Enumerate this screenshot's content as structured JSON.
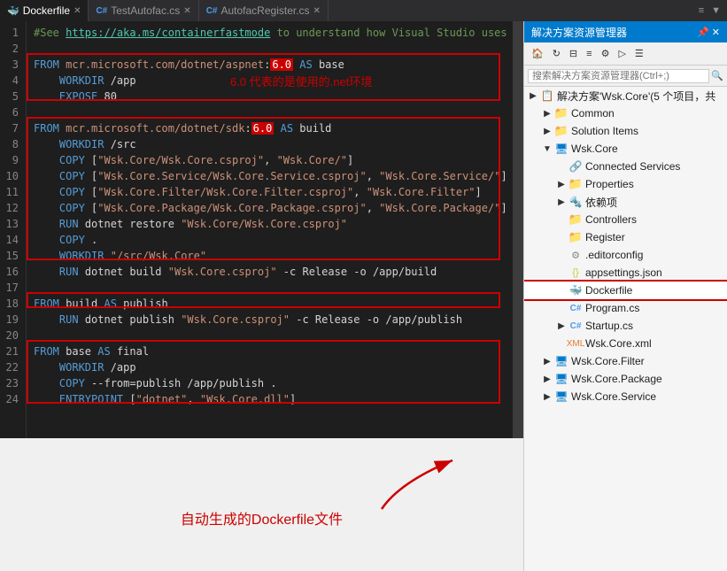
{
  "tabs": [
    {
      "label": "Dockerfile",
      "active": true,
      "modified": false
    },
    {
      "label": "TestAutofac.cs",
      "active": false
    },
    {
      "label": "AutofacRegister.cs",
      "active": false
    }
  ],
  "tab_actions": [
    "▼",
    "≡"
  ],
  "editor": {
    "lines": [
      {
        "num": 1,
        "content": "#See https://aka.ms/containerfastmode to understand how Visual Studio uses this Dockerfile to build yo",
        "type": "comment"
      },
      {
        "num": 2,
        "content": ""
      },
      {
        "num": 3,
        "content": "FROM mcr.microsoft.com/dotnet/aspnet:6.0 AS base",
        "highlight": "aspnet_from"
      },
      {
        "num": 4,
        "content": "    WORKDIR /app"
      },
      {
        "num": 5,
        "content": "    EXPOSE 80"
      },
      {
        "num": 6,
        "content": ""
      },
      {
        "num": 7,
        "content": "FROM mcr.microsoft.com/dotnet/sdk:6.0 AS build",
        "highlight": "sdk_from"
      },
      {
        "num": 8,
        "content": "    WORKDIR /src"
      },
      {
        "num": 9,
        "content": "    COPY [\"Wsk.Core/Wsk.Core.csproj\", \"Wsk.Core/\"]"
      },
      {
        "num": 10,
        "content": "    COPY [\"Wsk.Core.Service/Wsk.Core.Service.csproj\", \"Wsk.Core.Service/\"]"
      },
      {
        "num": 11,
        "content": "    COPY [\"Wsk.Core.Filter/Wsk.Core.Filter.csproj\", \"Wsk.Core.Filter\"]"
      },
      {
        "num": 12,
        "content": "    COPY [\"Wsk.Core.Package/Wsk.Core.Package.csproj\", \"Wsk.Core.Package/\"]"
      },
      {
        "num": 13,
        "content": "    RUN dotnet restore \"Wsk.Core/Wsk.Core.csproj\""
      },
      {
        "num": 14,
        "content": "    COPY ."
      },
      {
        "num": 15,
        "content": "    WORKDIR \"/src/Wsk.Core\""
      },
      {
        "num": 16,
        "content": "    RUN dotnet build \"Wsk.Core.csproj\" -c Release -o /app/build"
      },
      {
        "num": 17,
        "content": ""
      },
      {
        "num": 18,
        "content": "FROM build AS publish"
      },
      {
        "num": 19,
        "content": "    RUN dotnet publish \"Wsk.Core.csproj\" -c Release -o /app/publish"
      },
      {
        "num": 20,
        "content": ""
      },
      {
        "num": 21,
        "content": "FROM base AS final"
      },
      {
        "num": 22,
        "content": "    WORKDIR /app"
      },
      {
        "num": 23,
        "content": "    COPY --from=publish /app/publish ."
      },
      {
        "num": 24,
        "content": "    ENTRYPOINT [\"dotnet\", \"Wsk.Core.dll\"]"
      }
    ],
    "annotation1": "6.0 代表的是使用的.net环境",
    "annotation2": "自动生成的Dockerfile文件"
  },
  "solution_explorer": {
    "title": "解决方案资源管理器",
    "search_placeholder": "搜索解决方案资源管理器(Ctrl+;)",
    "solution_label": "解决方案'Wsk.Core'(5 个项目，共",
    "items": [
      {
        "indent": 0,
        "expand": "▶",
        "icon": "folder",
        "label": "Common"
      },
      {
        "indent": 0,
        "expand": "▶",
        "icon": "folder",
        "label": "Solution Items"
      },
      {
        "indent": 0,
        "expand": "▼",
        "icon": "proj",
        "label": "Wsk.Core"
      },
      {
        "indent": 1,
        "expand": " ",
        "icon": "connected",
        "label": "Connected Services"
      },
      {
        "indent": 1,
        "expand": "▶",
        "icon": "folder",
        "label": "Properties"
      },
      {
        "indent": 1,
        "expand": "▶",
        "icon": "deps",
        "label": "依赖项"
      },
      {
        "indent": 1,
        "expand": " ",
        "icon": "folder",
        "label": "Controllers"
      },
      {
        "indent": 1,
        "expand": " ",
        "icon": "folder",
        "label": "Register"
      },
      {
        "indent": 1,
        "expand": " ",
        "icon": "file",
        "label": ".editorconfig"
      },
      {
        "indent": 1,
        "expand": " ",
        "icon": "json",
        "label": "appsettings.json"
      },
      {
        "indent": 1,
        "expand": " ",
        "icon": "docker",
        "label": "Dockerfile",
        "selected": true
      },
      {
        "indent": 1,
        "expand": " ",
        "icon": "cs",
        "label": "Program.cs"
      },
      {
        "indent": 1,
        "expand": "▶",
        "icon": "cs",
        "label": "Startup.cs"
      },
      {
        "indent": 1,
        "expand": " ",
        "icon": "xml",
        "label": "Wsk.Core.xml"
      },
      {
        "indent": 0,
        "expand": "▶",
        "icon": "proj",
        "label": "Wsk.Core.Filter"
      },
      {
        "indent": 0,
        "expand": "▶",
        "icon": "proj",
        "label": "Wsk.Core.Package"
      },
      {
        "indent": 0,
        "expand": "▶",
        "icon": "proj",
        "label": "Wsk.Core.Service"
      }
    ]
  }
}
